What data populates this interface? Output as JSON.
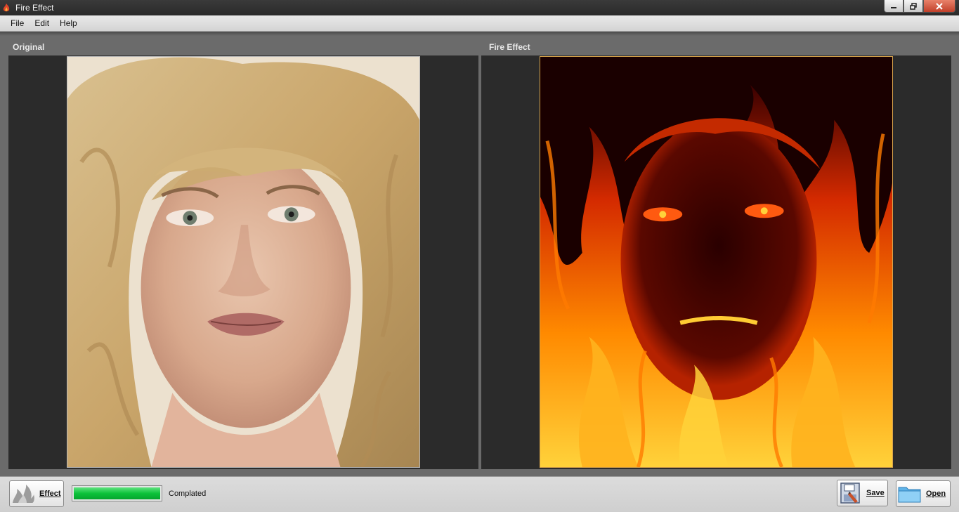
{
  "window": {
    "title": "Fire Effect"
  },
  "menu": {
    "items": [
      "File",
      "Edit",
      "Help"
    ]
  },
  "panels": {
    "left_label": "Original",
    "right_label": "Fire Effect"
  },
  "toolbar": {
    "effect_label": "Effect",
    "save_label": "Save",
    "open_label": "Open"
  },
  "status": {
    "progress": 1.0,
    "text": "Complated"
  },
  "colors": {
    "progress_green": "#0cc23a",
    "fire_orange": "#ff6a00",
    "panel_bg": "#2b2b2b"
  },
  "icons": {
    "app": "fire-icon",
    "effect": "flame-gray-icon",
    "save": "save-disk-icon",
    "open": "folder-icon"
  }
}
